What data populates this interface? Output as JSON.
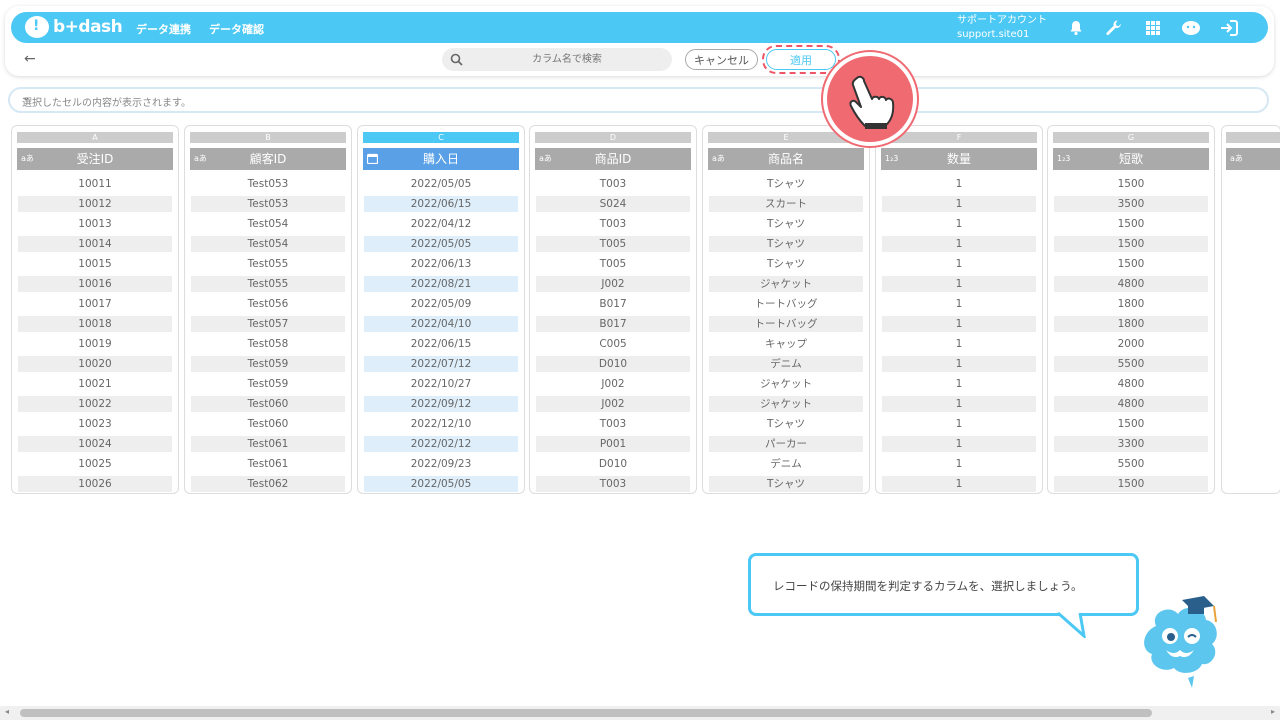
{
  "header": {
    "logo_text": "b+dash",
    "nav": [
      "データ連携",
      "データ確認"
    ],
    "account_label": "サポートアカウント",
    "account_id": "support.site01",
    "accent_color": "#4cc8f4"
  },
  "toolbar": {
    "search_placeholder": "カラム名で検索",
    "cancel_label": "キャンセル",
    "apply_label": "適用"
  },
  "cell_bar": {
    "placeholder": "選択したセルの内容が表示されます。"
  },
  "columns": [
    {
      "letter": "A",
      "type": "aあ",
      "header": "受注ID",
      "selected": false,
      "cells": [
        "10011",
        "10012",
        "10013",
        "10014",
        "10015",
        "10016",
        "10017",
        "10018",
        "10019",
        "10020",
        "10021",
        "10022",
        "10023",
        "10024",
        "10025",
        "10026"
      ]
    },
    {
      "letter": "B",
      "type": "aあ",
      "header": "顧客ID",
      "selected": false,
      "cells": [
        "Test053",
        "Test053",
        "Test054",
        "Test054",
        "Test055",
        "Test055",
        "Test056",
        "Test057",
        "Test058",
        "Test059",
        "Test059",
        "Test060",
        "Test060",
        "Test061",
        "Test061",
        "Test062"
      ]
    },
    {
      "letter": "C",
      "type": "calendar-icon",
      "header": "購入日",
      "selected": true,
      "cells": [
        "2022/05/05",
        "2022/06/15",
        "2022/04/12",
        "2022/05/05",
        "2022/06/13",
        "2022/08/21",
        "2022/05/09",
        "2022/04/10",
        "2022/06/15",
        "2022/07/12",
        "2022/10/27",
        "2022/09/12",
        "2022/12/10",
        "2022/02/12",
        "2022/09/23",
        "2022/05/05"
      ]
    },
    {
      "letter": "D",
      "type": "aあ",
      "header": "商品ID",
      "selected": false,
      "cells": [
        "T003",
        "S024",
        "T003",
        "T005",
        "T005",
        "J002",
        "B017",
        "B017",
        "C005",
        "D010",
        "J002",
        "J002",
        "T003",
        "P001",
        "D010",
        "T003"
      ]
    },
    {
      "letter": "E",
      "type": "aあ",
      "header": "商品名",
      "selected": false,
      "cells": [
        "Tシャツ",
        "スカート",
        "Tシャツ",
        "Tシャツ",
        "Tシャツ",
        "ジャケット",
        "トートバッグ",
        "トートバッグ",
        "キャップ",
        "デニム",
        "ジャケット",
        "ジャケット",
        "Tシャツ",
        "パーカー",
        "デニム",
        "Tシャツ"
      ]
    },
    {
      "letter": "F",
      "type": "1₂3",
      "header": "数量",
      "selected": false,
      "cells": [
        "1",
        "1",
        "1",
        "1",
        "1",
        "1",
        "1",
        "1",
        "1",
        "1",
        "1",
        "1",
        "1",
        "1",
        "1",
        "1"
      ]
    },
    {
      "letter": "G",
      "type": "1₂3",
      "header": "短歌",
      "selected": false,
      "cells": [
        "1500",
        "3500",
        "1500",
        "1500",
        "1500",
        "4800",
        "1800",
        "1800",
        "2000",
        "5500",
        "4800",
        "4800",
        "1500",
        "3300",
        "5500",
        "1500"
      ]
    }
  ],
  "partial_column": {
    "type": "aあ"
  },
  "tooltip": {
    "text": "レコードの保持期間を判定するカラムを、選択しましょう。"
  },
  "icons": {
    "bell": "bell-icon",
    "wrench": "wrench-icon",
    "grid": "grid-icon",
    "chat": "chat-icon",
    "logout": "logout-icon",
    "pointer": "pointing-hand-icon",
    "mascot": "mascot-icon"
  }
}
